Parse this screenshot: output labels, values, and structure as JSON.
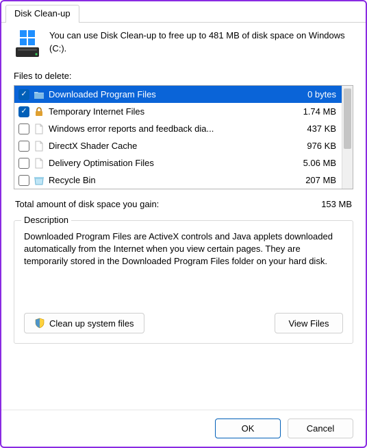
{
  "tab": {
    "label": "Disk Clean-up"
  },
  "intro": {
    "text": "You can use Disk Clean-up to free up to 481 MB of disk space on Windows (C:)."
  },
  "list": {
    "label": "Files to delete:",
    "items": [
      {
        "checked": true,
        "selected": true,
        "icon": "folder",
        "label": "Downloaded Program Files",
        "size": "0 bytes"
      },
      {
        "checked": true,
        "selected": false,
        "icon": "lock",
        "label": "Temporary Internet Files",
        "size": "1.74 MB"
      },
      {
        "checked": false,
        "selected": false,
        "icon": "file",
        "label": "Windows error reports and feedback dia...",
        "size": "437 KB"
      },
      {
        "checked": false,
        "selected": false,
        "icon": "file",
        "label": "DirectX Shader Cache",
        "size": "976 KB"
      },
      {
        "checked": false,
        "selected": false,
        "icon": "file",
        "label": "Delivery Optimisation Files",
        "size": "5.06 MB"
      },
      {
        "checked": false,
        "selected": false,
        "icon": "recycle",
        "label": "Recycle Bin",
        "size": "207 MB"
      }
    ]
  },
  "total": {
    "label": "Total amount of disk space you gain:",
    "value": "153 MB"
  },
  "description": {
    "legend": "Description",
    "text": "Downloaded Program Files are ActiveX controls and Java applets downloaded automatically from the Internet when you view certain pages. They are temporarily stored in the Downloaded Program Files folder on your hard disk."
  },
  "buttons": {
    "cleanup_system": "Clean up system files",
    "view_files": "View Files",
    "ok": "OK",
    "cancel": "Cancel"
  }
}
